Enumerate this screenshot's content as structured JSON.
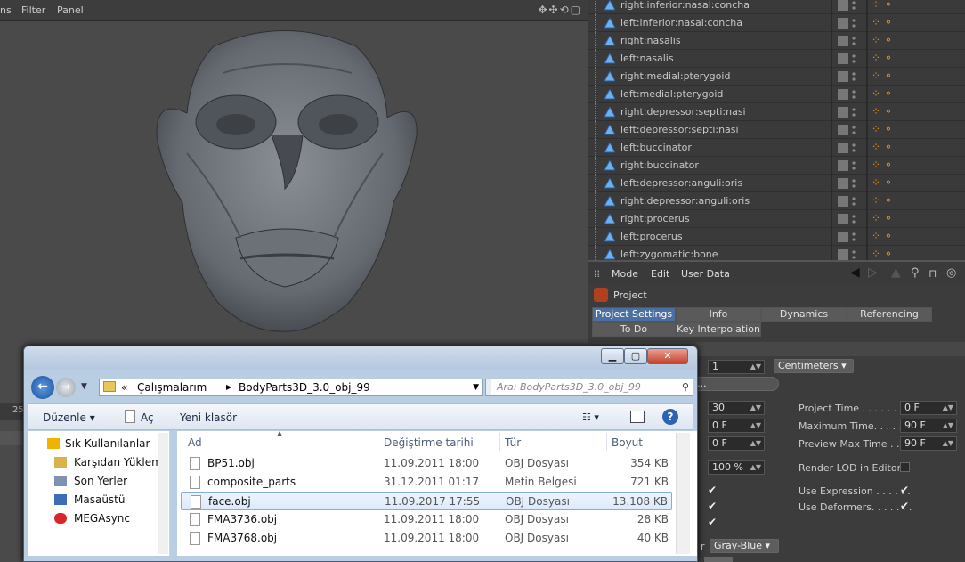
{
  "viewport": {
    "menu": [
      "ns",
      "Filter",
      "Panel"
    ],
    "nav_icons": "✥✣⟲▢",
    "timeline_label": "25"
  },
  "object_manager": {
    "rows": [
      "right:inferior:nasal:concha",
      "left:inferior:nasal:concha",
      "right:nasalis",
      "left:nasalis",
      "right:medial:pterygoid",
      "left:medial:pterygoid",
      "right:depressor:septi:nasi",
      "left:depressor:septi:nasi",
      "left:buccinator",
      "right:buccinator",
      "left:depressor:anguli:oris",
      "right:depressor:anguli:oris",
      "right:procerus",
      "left:procerus",
      "left:zygomatic:bone"
    ]
  },
  "attribute_manager": {
    "menu": [
      "Mode",
      "Edit",
      "User Data"
    ],
    "title": "Project",
    "tabs_row1": [
      "Project Settings",
      "Info",
      "Dynamics",
      "Referencing"
    ],
    "tabs_row2": [
      "To Do",
      "Key Interpolation"
    ],
    "scale_value": "1",
    "scale_unit": "Centimeters",
    "scale_button": "ect...",
    "fps": "30",
    "min_time": "0 F",
    "preview_min": "0 F",
    "lod": "100 %",
    "project_time_label": "Project Time . . . . . . . . .",
    "project_time": "0 F",
    "max_time_label": "Maximum Time. . . . . . .",
    "max_time": "90 F",
    "preview_max_label": "Preview Max Time . . .",
    "preview_max": "90 F",
    "render_lod_label": "Render LOD in Editor",
    "use_expression_label": "Use Expression . . . . . .",
    "use_deformers_label": "Use Deformers. . . . . . .",
    "default_color": "Gray-Blue",
    "color_label": "r"
  },
  "dialog": {
    "address": [
      "«",
      "Çalışmalarım",
      "BodyParts3D_3.0_obj_99"
    ],
    "search_placeholder": "Ara: BodyParts3D_3.0_obj_99",
    "toolbar": {
      "organize": "Düzenle",
      "open": "Aç",
      "new_folder": "Yeni klasör"
    },
    "nav": [
      {
        "label": "Sık Kullanılanlar",
        "icon": "star-icon"
      },
      {
        "label": "Karşıdan Yüklem",
        "icon": "download-folder-icon"
      },
      {
        "label": "Son Yerler",
        "icon": "recent-places-icon"
      },
      {
        "label": "Masaüstü",
        "icon": "desktop-icon"
      },
      {
        "label": "MEGAsync",
        "icon": "mega-icon"
      }
    ],
    "columns": [
      "Ad",
      "Değiştirme tarihi",
      "Tür",
      "Boyut"
    ],
    "files": [
      {
        "name": "BP51.obj",
        "date": "11.09.2011 18:00",
        "type": "OBJ Dosyası",
        "size": "354 KB"
      },
      {
        "name": "composite_parts",
        "date": "31.12.2011 01:17",
        "type": "Metin Belgesi",
        "size": "721 KB"
      },
      {
        "name": "face.obj",
        "date": "11.09.2017 17:55",
        "type": "OBJ Dosyası",
        "size": "13.108 KB"
      },
      {
        "name": "FMA3736.obj",
        "date": "11.09.2011 18:00",
        "type": "OBJ Dosyası",
        "size": "28 KB"
      },
      {
        "name": "FMA3768.obj",
        "date": "11.09.2011 18:00",
        "type": "OBJ Dosyası",
        "size": "40 KB"
      }
    ]
  }
}
